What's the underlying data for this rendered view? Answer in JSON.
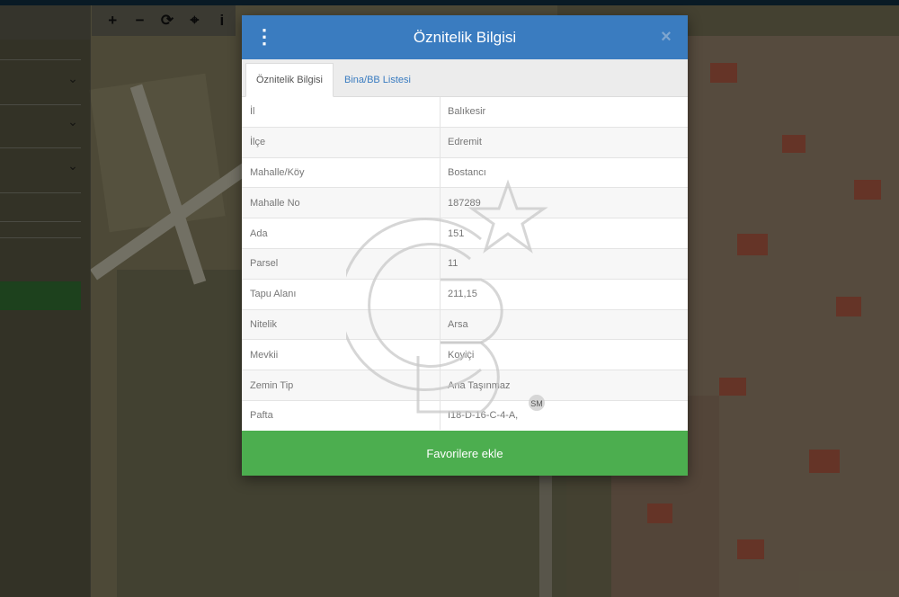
{
  "map_toolbar": {
    "tools": [
      {
        "icon": "zoom-in-icon",
        "glyph": "+"
      },
      {
        "icon": "zoom-out-icon",
        "glyph": "−"
      },
      {
        "icon": "refresh-icon",
        "glyph": "⟳"
      },
      {
        "icon": "locate-icon",
        "glyph": "⌖"
      },
      {
        "icon": "info-icon",
        "glyph": "i"
      }
    ]
  },
  "dialog": {
    "title": "Öznitelik Bilgisi",
    "menu_glyph": "⋮",
    "close_glyph": "×",
    "tabs": [
      {
        "label": "Öznitelik Bilgisi",
        "active": true
      },
      {
        "label": "Bina/BB Listesi",
        "active": false
      }
    ],
    "rows": [
      {
        "key": "İl",
        "value": "Balıkesir"
      },
      {
        "key": "İlçe",
        "value": "Edremit"
      },
      {
        "key": "Mahalle/Köy",
        "value": "Bostancı"
      },
      {
        "key": "Mahalle No",
        "value": "187289"
      },
      {
        "key": "Ada",
        "value": "151"
      },
      {
        "key": "Parsel",
        "value": "11"
      },
      {
        "key": "Tapu Alanı",
        "value": "211,15"
      },
      {
        "key": "Nitelik",
        "value": "Arsa"
      },
      {
        "key": "Mevkii",
        "value": "Koyiçi"
      },
      {
        "key": "Zemin Tip",
        "value": "Ana Taşınmaz"
      },
      {
        "key": "Pafta",
        "value": "I18-D-16-C-4-A,"
      }
    ],
    "favorite_label": "Favorilere ekle"
  },
  "watermark": {
    "icon": "cb-logo-watermark",
    "mark": "SM"
  },
  "colors": {
    "header": "#3a7cc0",
    "favorite_button": "#4cae4f",
    "tab_link": "#3a7cc0"
  }
}
